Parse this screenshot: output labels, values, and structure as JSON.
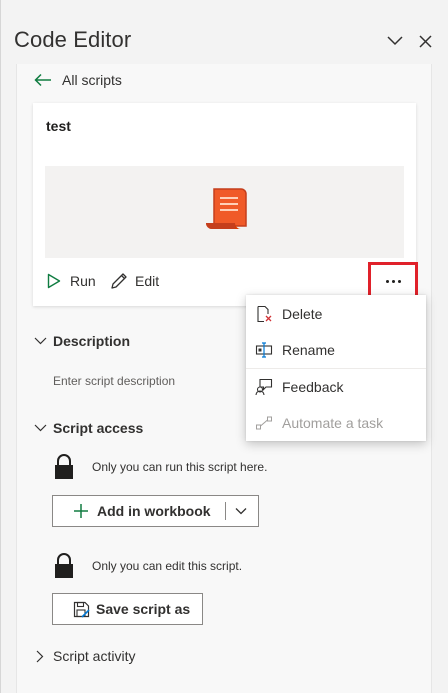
{
  "header": {
    "title": "Code Editor"
  },
  "nav": {
    "back_label": "All scripts"
  },
  "script": {
    "name": "test",
    "run_label": "Run",
    "edit_label": "Edit"
  },
  "menu": {
    "items": [
      {
        "label": "Delete",
        "icon": "delete-icon",
        "enabled": true
      },
      {
        "label": "Rename",
        "icon": "rename-icon",
        "enabled": true
      },
      {
        "label": "Feedback",
        "icon": "feedback-icon",
        "enabled": true
      },
      {
        "label": "Automate a task",
        "icon": "automate-icon",
        "enabled": false
      }
    ]
  },
  "description": {
    "title": "Description",
    "placeholder": "Enter script description"
  },
  "access": {
    "title": "Script access",
    "run_note": "Only you can run this script here.",
    "add_button": "Add in workbook",
    "edit_note": "Only you can edit this script.",
    "save_button": "Save script as"
  },
  "activity": {
    "title": "Script activity"
  },
  "colors": {
    "accent_green": "#107c41",
    "script_icon": "#d83b01",
    "highlight_red": "#e0212a"
  }
}
